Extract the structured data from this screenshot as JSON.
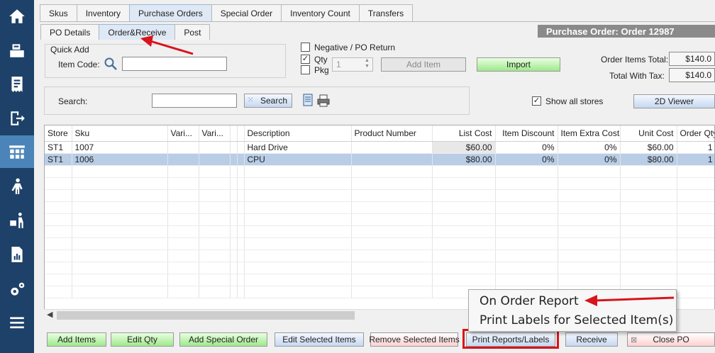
{
  "nav": {
    "items": [
      {
        "icon": "home-icon"
      },
      {
        "icon": "register-icon"
      },
      {
        "icon": "receipt-icon"
      },
      {
        "icon": "logout-icon"
      },
      {
        "icon": "inventory-icon",
        "active": true
      },
      {
        "icon": "customer-icon"
      },
      {
        "icon": "delivery-icon"
      },
      {
        "icon": "report-icon"
      },
      {
        "icon": "settings-icon"
      },
      {
        "icon": "menu-icon"
      }
    ]
  },
  "tabs": {
    "main": [
      "Skus",
      "Inventory",
      "Purchase Orders",
      "Special Order",
      "Inventory Count",
      "Transfers"
    ],
    "sub": [
      "PO Details",
      "Order&Receive",
      "Post"
    ]
  },
  "po_title": "Purchase Order:  Order 12987",
  "quick_add": {
    "title": "Quick Add",
    "item_code_label": "Item Code:",
    "item_code_value": ""
  },
  "options": {
    "negative_label": "Negative / PO Return",
    "qty_label": "Qty",
    "pkg_label": "Pkg",
    "qty_value": "1",
    "add_item": "Add Item",
    "import": "Import"
  },
  "totals": {
    "order_items_label": "Order Items Total:",
    "order_items_value": "$140.0",
    "with_tax_label": "Total With Tax:",
    "with_tax_value": "$140.0"
  },
  "search": {
    "label": "Search:",
    "value": "",
    "button": "Search"
  },
  "show_all_stores": "Show all stores",
  "viewer_button": "2D Viewer",
  "grid": {
    "columns": [
      "Store",
      "Sku",
      "Vari...",
      "Vari...",
      "",
      "",
      "Description",
      "Product Number",
      "List Cost",
      "Item Discount",
      "Item Extra Costs",
      "Unit Cost",
      "Order Qty"
    ],
    "rows": [
      {
        "store": "ST1",
        "sku": "1007",
        "description": "Hard Drive",
        "list_cost": "$60.00",
        "item_discount": "0%",
        "extra_costs": "0%",
        "unit_cost": "$60.00",
        "order_qty": "1"
      },
      {
        "store": "ST1",
        "sku": "1006",
        "description": "CPU",
        "list_cost": "$80.00",
        "item_discount": "0%",
        "extra_costs": "0%",
        "unit_cost": "$80.00",
        "order_qty": "1"
      }
    ]
  },
  "menu": {
    "items": [
      "On Order Report",
      "Print Labels for Selected Item(s)"
    ]
  },
  "bottom_buttons": {
    "add_items": "Add Items",
    "edit_qty": "Edit Qty",
    "add_special_order": "Add Special Order",
    "edit_selected": "Edit Selected Items",
    "remove_selected": "Remove Selected Items",
    "print_reports": "Print Reports/Labels",
    "receive": "Receive",
    "close_po": "Close PO"
  },
  "colors": {
    "nav_bg": "#1d4168",
    "nav_active": "#4a84b8",
    "annotation": "#d8141c"
  }
}
